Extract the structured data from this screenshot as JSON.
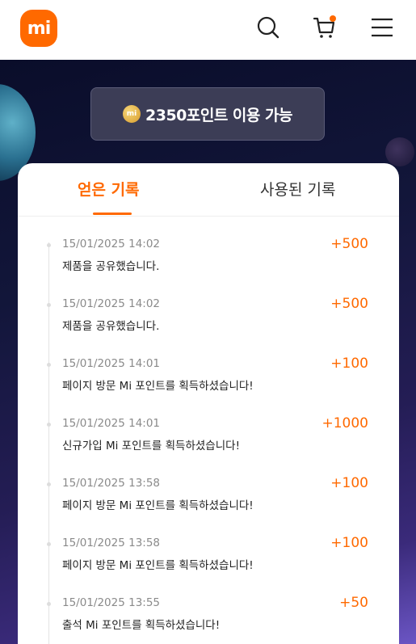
{
  "header": {
    "logo_text": "mi",
    "icons": [
      "search-icon",
      "cart-icon",
      "menu-icon"
    ],
    "cart_badge_color": "#ff6900"
  },
  "points": {
    "coin_text": "mi",
    "text": "2350포인트 이용 가능"
  },
  "tabs": [
    {
      "label": "얻은 기록",
      "active": true
    },
    {
      "label": "사용된 기록",
      "active": false
    }
  ],
  "records": [
    {
      "time": "15/01/2025 14:02",
      "desc": "제품을 공유했습니다.",
      "amount": "+500"
    },
    {
      "time": "15/01/2025 14:02",
      "desc": "제품을 공유했습니다.",
      "amount": "+500"
    },
    {
      "time": "15/01/2025 14:01",
      "desc": "페이지 방문 Mi 포인트를 획득하셨습니다!",
      "amount": "+100"
    },
    {
      "time": "15/01/2025 14:01",
      "desc": "신규가입 Mi 포인트를 획득하셨습니다!",
      "amount": "+1000"
    },
    {
      "time": "15/01/2025 13:58",
      "desc": "페이지 방문 Mi 포인트를 획득하셨습니다!",
      "amount": "+100"
    },
    {
      "time": "15/01/2025 13:58",
      "desc": "페이지 방문 Mi 포인트를 획득하셨습니다!",
      "amount": "+100"
    },
    {
      "time": "15/01/2025 13:55",
      "desc": "출석 Mi 포인트를 획득하셨습니다!",
      "amount": "+50"
    }
  ],
  "colors": {
    "accent": "#ff6900",
    "text_dark": "#222222",
    "text_muted": "#8a8a8a"
  }
}
